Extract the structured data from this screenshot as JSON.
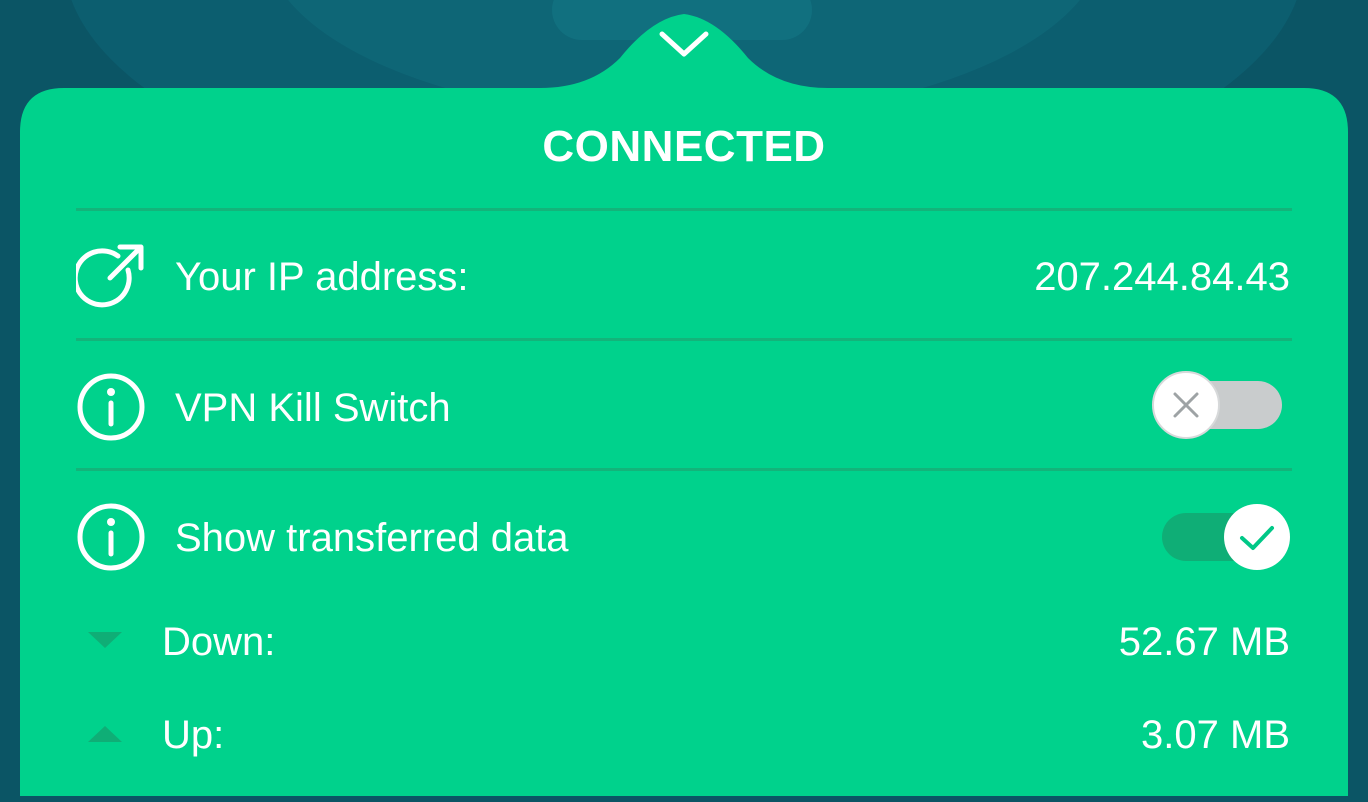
{
  "status": {
    "title": "CONNECTED"
  },
  "rows": {
    "ip": {
      "label": "Your IP address:",
      "value": "207.244.84.43",
      "icon": "external-link-icon"
    },
    "kill_switch": {
      "label": "VPN Kill Switch",
      "icon": "info-icon",
      "enabled": false
    },
    "transferred": {
      "label": "Show transferred data",
      "icon": "info-icon",
      "enabled": true
    }
  },
  "traffic": {
    "down": {
      "label": "Down:",
      "value": "52.67 MB",
      "icon": "arrow-down-icon"
    },
    "up": {
      "label": "Up:",
      "value": "3.07 MB",
      "icon": "arrow-up-icon"
    }
  },
  "colors": {
    "panel": "#00d28c",
    "background": "#0d5a6a",
    "divider": "#13b47a",
    "toggle_off_track": "#c9cccd",
    "toggle_on_track": "#0fae76",
    "toggle_on_check": "#00c887"
  }
}
